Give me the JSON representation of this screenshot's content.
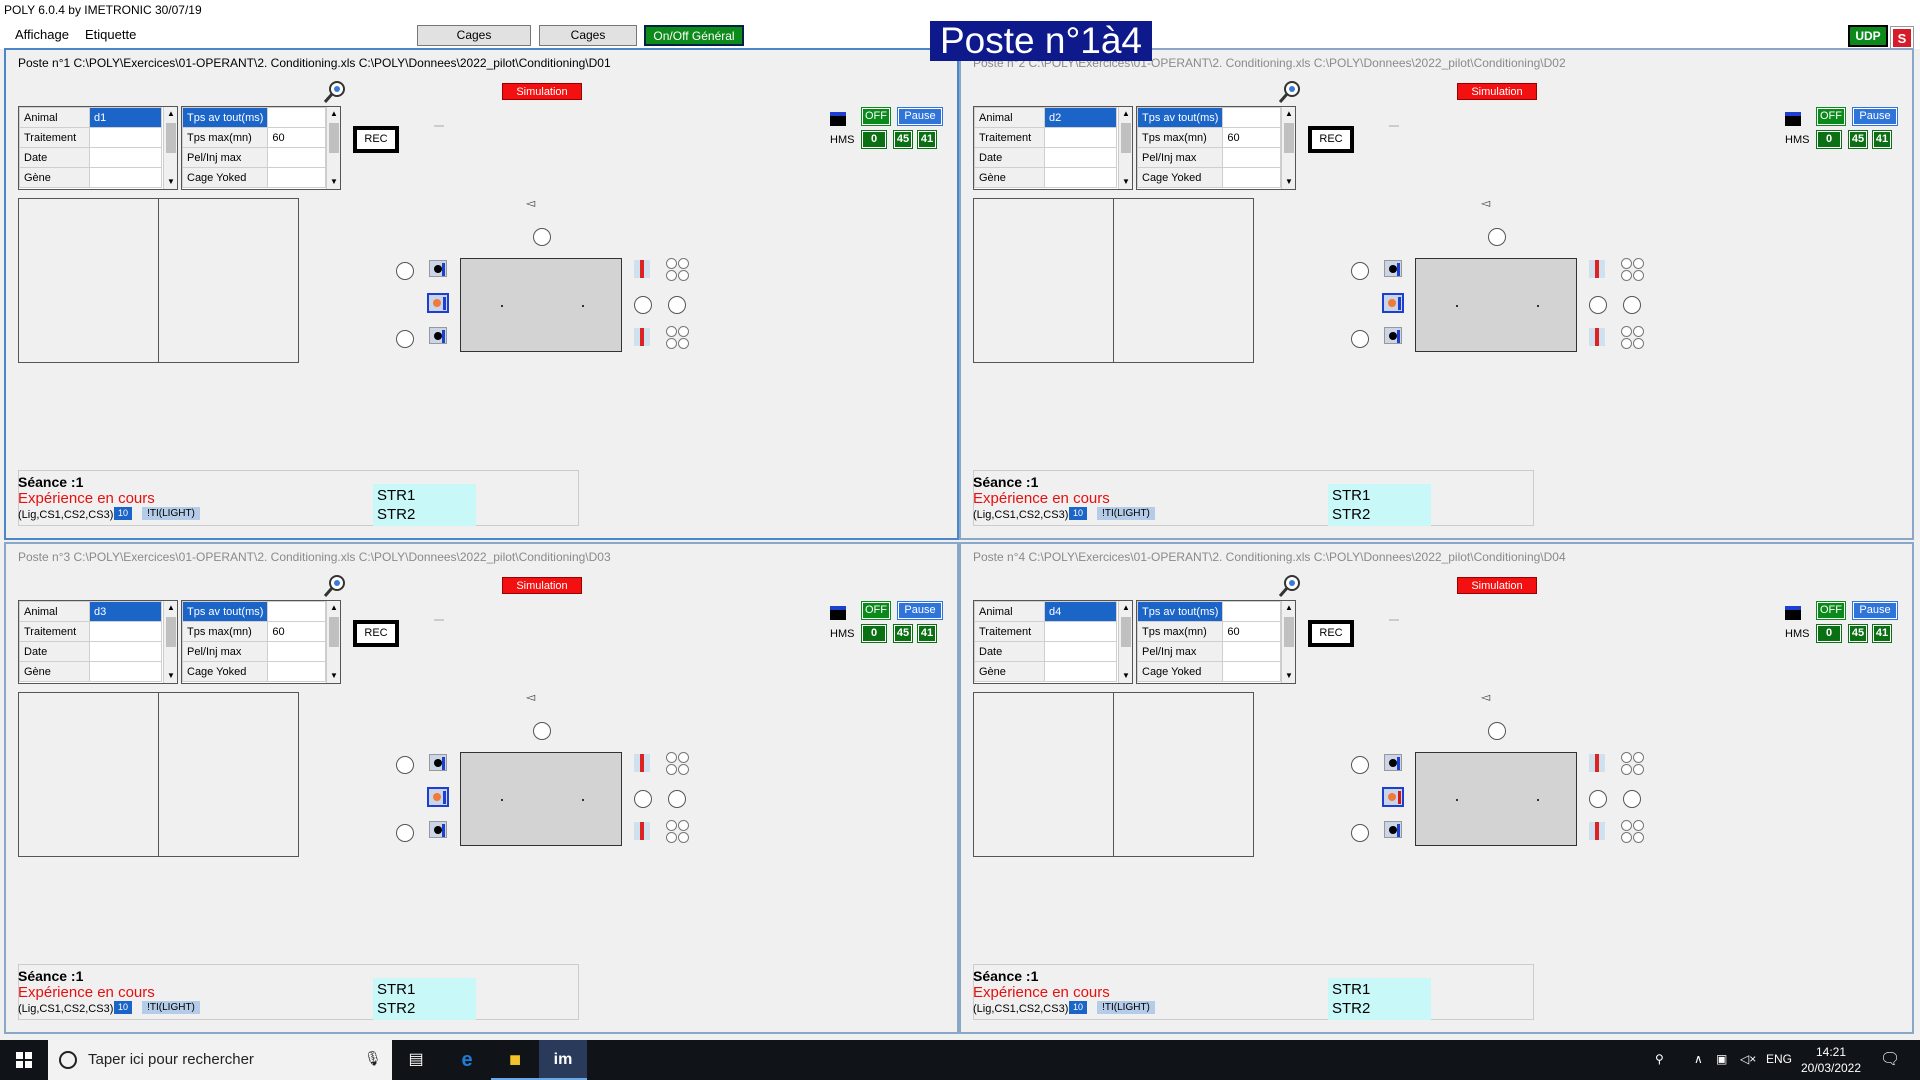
{
  "app": {
    "title": "POLY 6.0.4 by IMETRONIC  30/07/19"
  },
  "menu": {
    "items": [
      "Affichage",
      "Etiquette"
    ],
    "prev_cages": "Cages précédentes",
    "next_cages": "Cages suivantes",
    "onoff": "On/Off Général",
    "poste_banner": "Poste n°1à4",
    "udp": "UDP",
    "s": "S"
  },
  "panels": [
    {
      "header": "Poste n°1   C:\\POLY\\Exercices\\01-OPERANT\\2. Conditioning.xls   C:\\POLY\\Donnees\\2022_pilot\\Conditioning\\D01",
      "simulation": "Simulation",
      "grid_left": [
        [
          "Animal",
          "d1"
        ],
        [
          "Traitement",
          ""
        ],
        [
          "Date",
          ""
        ],
        [
          "Gène",
          ""
        ]
      ],
      "grid_right": [
        [
          "Tps av tout(ms)",
          ""
        ],
        [
          "Tps max(mn)",
          "60"
        ],
        [
          "Pel/Inj max",
          ""
        ],
        [
          "Cage Yoked",
          ""
        ]
      ],
      "rec": "REC",
      "off": "OFF",
      "pause": "Pause",
      "hms": "HMS",
      "time": [
        "0",
        "45",
        "41"
      ],
      "seance": "Séance :1",
      "exp": "Expérience en cours",
      "cs": "(Lig,CS1,CS2,CS3)",
      "tag1": "10",
      "tag2": "!TI(LIGHT)",
      "str1": "STR1",
      "str2": "STR2"
    },
    {
      "header": "Poste n°2   C:\\POLY\\Exercices\\01-OPERANT\\2. Conditioning.xls   C:\\POLY\\Donnees\\2022_pilot\\Conditioning\\D02",
      "simulation": "Simulation",
      "grid_left": [
        [
          "Animal",
          "d2"
        ],
        [
          "Traitement",
          ""
        ],
        [
          "Date",
          ""
        ],
        [
          "Gène",
          ""
        ]
      ],
      "grid_right": [
        [
          "Tps av tout(ms)",
          ""
        ],
        [
          "Tps max(mn)",
          "60"
        ],
        [
          "Pel/Inj max",
          ""
        ],
        [
          "Cage Yoked",
          ""
        ]
      ],
      "rec": "REC",
      "off": "OFF",
      "pause": "Pause",
      "hms": "HMS",
      "time": [
        "0",
        "45",
        "41"
      ],
      "seance": "Séance :1",
      "exp": "Expérience en cours",
      "cs": "(Lig,CS1,CS2,CS3)",
      "tag1": "10",
      "tag2": "!TI(LIGHT)",
      "str1": "STR1",
      "str2": "STR2"
    },
    {
      "header": "Poste n°3   C:\\POLY\\Exercices\\01-OPERANT\\2. Conditioning.xls   C:\\POLY\\Donnees\\2022_pilot\\Conditioning\\D03",
      "simulation": "Simulation",
      "grid_left": [
        [
          "Animal",
          "d3"
        ],
        [
          "Traitement",
          ""
        ],
        [
          "Date",
          ""
        ],
        [
          "Gène",
          ""
        ]
      ],
      "grid_right": [
        [
          "Tps av tout(ms)",
          ""
        ],
        [
          "Tps max(mn)",
          "60"
        ],
        [
          "Pel/Inj max",
          ""
        ],
        [
          "Cage Yoked",
          ""
        ]
      ],
      "rec": "REC",
      "off": "OFF",
      "pause": "Pause",
      "hms": "HMS",
      "time": [
        "0",
        "45",
        "41"
      ],
      "seance": "Séance :1",
      "exp": "Expérience en cours",
      "cs": "(Lig,CS1,CS2,CS3)",
      "tag1": "10",
      "tag2": "!TI(LIGHT)",
      "str1": "STR1",
      "str2": "STR2"
    },
    {
      "header": "Poste n°4   C:\\POLY\\Exercices\\01-OPERANT\\2. Conditioning.xls   C:\\POLY\\Donnees\\2022_pilot\\Conditioning\\D04",
      "simulation": "Simulation",
      "grid_left": [
        [
          "Animal",
          "d4"
        ],
        [
          "Traitement",
          ""
        ],
        [
          "Date",
          ""
        ],
        [
          "Gène",
          ""
        ]
      ],
      "grid_right": [
        [
          "Tps av tout(ms)",
          ""
        ],
        [
          "Tps max(mn)",
          "60"
        ],
        [
          "Pel/Inj max",
          ""
        ],
        [
          "Cage Yoked",
          ""
        ]
      ],
      "rec": "REC",
      "off": "OFF",
      "pause": "Pause",
      "hms": "HMS",
      "time": [
        "0",
        "45",
        "41"
      ],
      "seance": "Séance :1",
      "exp": "Expérience en cours",
      "cs": "(Lig,CS1,CS2,CS3)",
      "tag1": "10",
      "tag2": "!TI(LIGHT)",
      "str1": "STR1",
      "str2": "STR2"
    }
  ],
  "taskbar": {
    "search_placeholder": "Taper ici pour rechercher",
    "lang": "ENG",
    "time": "14:21",
    "date": "20/03/2022"
  },
  "colors": {
    "sim_red": "#f31010",
    "green": "#0b8a1b",
    "blue": "#2f74d8",
    "banner": "#0e1a8c"
  }
}
